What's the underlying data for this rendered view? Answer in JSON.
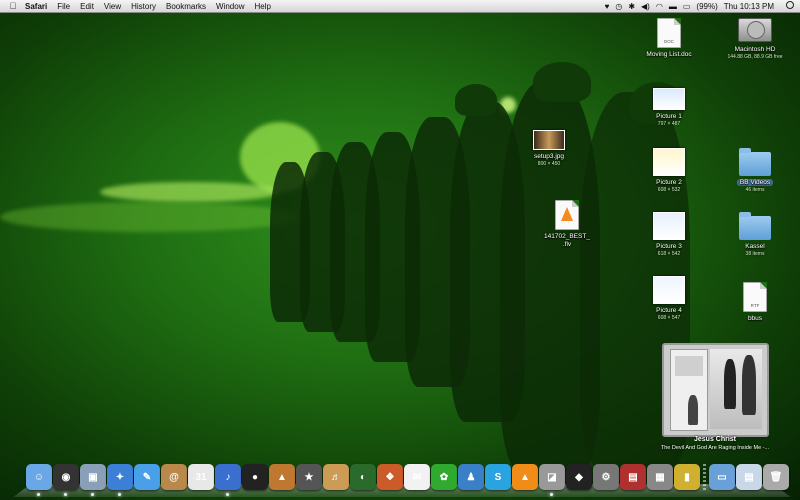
{
  "menubar": {
    "apple": "",
    "app": "Safari",
    "menus": [
      "File",
      "Edit",
      "View",
      "History",
      "Bookmarks",
      "Window",
      "Help"
    ],
    "battery": "(99%)",
    "clock": "Thu 10:13 PM"
  },
  "desktop": {
    "icons": [
      {
        "name": "Moving List.doc",
        "sub": "",
        "tag": "DOC"
      },
      {
        "name": "Macintosh HD",
        "sub": "144.88 GB, 88.9 GB free"
      },
      {
        "name": "Picture 1",
        "sub": "797 × 487"
      },
      {
        "name": "setup3.jpg",
        "sub": "800 × 450"
      },
      {
        "name": "Picture 2",
        "sub": "608 × 532"
      },
      {
        "name": "BB Videos",
        "sub": "46 items"
      },
      {
        "name": "141702_BEST_",
        "sub": ".flv"
      },
      {
        "name": "Picture 3",
        "sub": "618 × 542"
      },
      {
        "name": "Kassel",
        "sub": "38 items"
      },
      {
        "name": "Picture 4",
        "sub": "608 × 547"
      },
      {
        "name": "bbus",
        "sub": "",
        "tag": "RTF"
      }
    ]
  },
  "itunes_widget": {
    "title": "Jesus Christ",
    "subtitle": "The Devil And God Are Raging Inside Me -..."
  },
  "dock": {
    "items": [
      {
        "icon": "finder-icon",
        "glyph": "☺",
        "color": "#6aa7e6"
      },
      {
        "icon": "dashboard-icon",
        "glyph": "◉",
        "color": "#333"
      },
      {
        "icon": "preview-icon",
        "glyph": "▣",
        "color": "#8aa0b8"
      },
      {
        "icon": "safari-icon",
        "glyph": "✦",
        "color": "#3b7fd6"
      },
      {
        "icon": "ichat-icon",
        "glyph": "✎",
        "color": "#4aa0e8"
      },
      {
        "icon": "address-book-icon",
        "glyph": "@",
        "color": "#b8894a"
      },
      {
        "icon": "ical-icon",
        "glyph": "31",
        "color": "#e8e8e8"
      },
      {
        "icon": "itunes-icon",
        "glyph": "♪",
        "color": "#3a6fd0"
      },
      {
        "icon": "dvd-player-icon",
        "glyph": "●",
        "color": "#222"
      },
      {
        "icon": "iphoto-icon",
        "glyph": "▲",
        "color": "#c07830"
      },
      {
        "icon": "imovie-icon",
        "glyph": "★",
        "color": "#555"
      },
      {
        "icon": "garageband-icon",
        "glyph": "♬",
        "color": "#cc9b55"
      },
      {
        "icon": "time-machine-icon",
        "glyph": "◐",
        "color": "#2a6a2a"
      },
      {
        "icon": "app-store-icon",
        "glyph": "❖",
        "color": "#cc5b2a"
      },
      {
        "icon": "mail-icon",
        "glyph": "✉",
        "color": "#f2f2f2"
      },
      {
        "icon": "icq-icon",
        "glyph": "✿",
        "color": "#2faa2f"
      },
      {
        "icon": "messenger-icon",
        "glyph": "♟",
        "color": "#3a80c8"
      },
      {
        "icon": "skype-icon",
        "glyph": "S",
        "color": "#2aa4e0"
      },
      {
        "icon": "vlc-icon",
        "glyph": "▲",
        "color": "#f08c18"
      },
      {
        "icon": "disk-utility-icon",
        "glyph": "◪",
        "color": "#999"
      },
      {
        "icon": "front-row-icon",
        "glyph": "◆",
        "color": "#222"
      },
      {
        "icon": "system-preferences-icon",
        "glyph": "⚙",
        "color": "#777"
      },
      {
        "icon": "photo-booth-icon",
        "glyph": "▤",
        "color": "#b03030"
      },
      {
        "icon": "activity-monitor-icon",
        "glyph": "▦",
        "color": "#888"
      },
      {
        "icon": "utilities-icon",
        "glyph": "▮",
        "color": "#d0b030"
      },
      {
        "icon": "applications-folder-icon",
        "glyph": "▭",
        "color": "#6aa0d8"
      },
      {
        "icon": "documents-folder-icon",
        "glyph": "▤",
        "color": "#c8d8e8"
      },
      {
        "icon": "trash-icon",
        "glyph": "🗑",
        "color": "#aaa"
      }
    ]
  }
}
